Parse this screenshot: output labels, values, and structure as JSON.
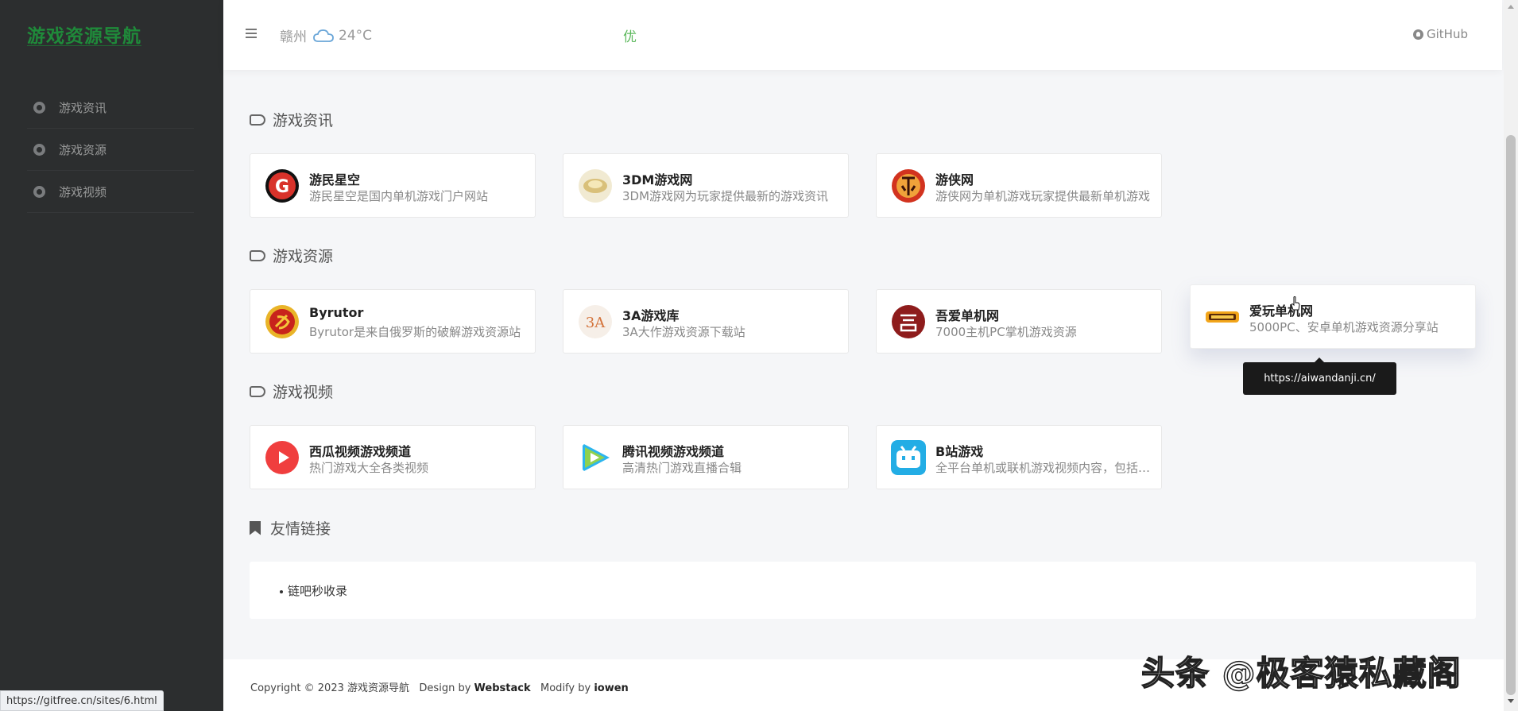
{
  "sidebar": {
    "logo": "游戏资源导航",
    "items": [
      {
        "label": "游戏资讯"
      },
      {
        "label": "游戏资源"
      },
      {
        "label": "游戏视频"
      }
    ]
  },
  "header": {
    "city": "赣州",
    "temperature": "24°C",
    "air_quality": "优",
    "github_label": "GitHub"
  },
  "sections": {
    "news": {
      "title": "游戏资讯",
      "cards": [
        {
          "title": "游民星空",
          "desc": "游民星空是国内单机游戏门户网站"
        },
        {
          "title": "3DM游戏网",
          "desc": "3DM游戏网为玩家提供最新的游戏资讯"
        },
        {
          "title": "游侠网",
          "desc": "游侠网为单机游戏玩家提供最新单机游戏"
        }
      ]
    },
    "resources": {
      "title": "游戏资源",
      "cards": [
        {
          "title": "Byrutor",
          "desc": "Byrutor是来自俄罗斯的破解游戏资源站"
        },
        {
          "title": "3A游戏库",
          "desc": "3A大作游戏资源下载站"
        },
        {
          "title": "吾爱单机网",
          "desc": "7000主机PC掌机游戏资源"
        },
        {
          "title": "爱玩单机网",
          "desc": "5000PC、安卓单机游戏资源分享站"
        }
      ]
    },
    "video": {
      "title": "游戏视频",
      "cards": [
        {
          "title": "西瓜视频游戏频道",
          "desc": "热门游戏大全各类视频"
        },
        {
          "title": "腾讯视频游戏频道",
          "desc": "高清热门游戏直播合辑"
        },
        {
          "title": "B站游戏",
          "desc": "全平台单机或联机游戏视频内容，包括攻略"
        }
      ]
    },
    "friends": {
      "title": "友情链接",
      "items": [
        {
          "label": "链吧秒收录"
        }
      ]
    }
  },
  "tooltip": {
    "url": "https://aiwandanji.cn/"
  },
  "footer": {
    "copyright": "Copyright © 2023 游戏资源导航",
    "design_prefix": "Design by",
    "design_by": "Webstack",
    "modify_prefix": "Modify by",
    "modify_by": "iowen"
  },
  "status_bar": {
    "url": "https://gitfree.cn/sites/6.html"
  },
  "watermark": "头条 @极客猿私藏阁",
  "colors": {
    "sidebar_bg": "#2c2e2f",
    "logo_green": "#1f8a3a",
    "air_quality_green": "#5cb85c"
  }
}
